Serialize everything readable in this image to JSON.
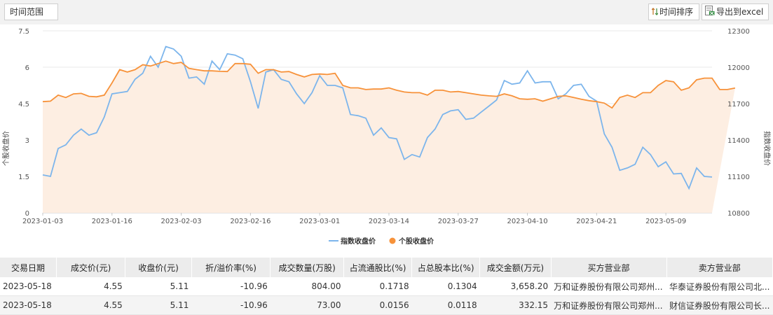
{
  "toolbar": {
    "range_label": "时间范围",
    "sort_label": "时间排序",
    "export_label": "导出到excel"
  },
  "chart_data": {
    "type": "line",
    "y_left": {
      "label": "个股收盘价",
      "ticks": [
        "7.5",
        "6",
        "4.5",
        "3",
        "1.5",
        "0"
      ],
      "range": [
        0,
        7.5
      ]
    },
    "y_right": {
      "label": "指数收盘价",
      "ticks": [
        "12300",
        "12000",
        "11700",
        "11400",
        "11100",
        "10800"
      ],
      "range": [
        10800,
        12300
      ]
    },
    "x_ticks": [
      "2023-01-03",
      "2023-01-16",
      "2023-02-03",
      "2023-02-16",
      "2023-03-01",
      "2023-03-14",
      "2023-03-27",
      "2023-04-10",
      "2023-04-21",
      "2023-05-09"
    ],
    "x_tick_index": [
      0,
      9,
      18,
      27,
      36,
      45,
      54,
      63,
      72,
      81
    ],
    "n_points": 88,
    "legend": "bottom-center",
    "grid": "horizontal",
    "colors": {
      "index": "#7cb5ec",
      "stock": "#f7923a",
      "fill": "#fdeee2"
    },
    "series": [
      {
        "name": "指数收盘价",
        "axis": "right",
        "values": [
          11112,
          11100,
          11330,
          11360,
          11440,
          11490,
          11440,
          11460,
          11590,
          11780,
          11790,
          11800,
          11900,
          11950,
          12090,
          12000,
          12170,
          12150,
          12090,
          11910,
          11920,
          11860,
          12050,
          11980,
          12110,
          12100,
          12070,
          11880,
          11660,
          11960,
          11980,
          11900,
          11880,
          11780,
          11700,
          11790,
          11930,
          11850,
          11850,
          11830,
          11610,
          11600,
          11580,
          11440,
          11500,
          11420,
          11410,
          11240,
          11280,
          11260,
          11420,
          11490,
          11610,
          11640,
          11650,
          11570,
          11580,
          11630,
          11680,
          11730,
          11890,
          11860,
          11870,
          11970,
          11870,
          11880,
          11880,
          11740,
          11780,
          11850,
          11860,
          11760,
          11720,
          11450,
          11340,
          11150,
          11170,
          11200,
          11340,
          11280,
          11180,
          11220,
          11120,
          11125,
          11000,
          11170,
          11100,
          11095
        ]
      },
      {
        "name": "个股收盘价",
        "axis": "left",
        "values": [
          4.58,
          4.6,
          4.85,
          4.75,
          4.9,
          4.92,
          4.8,
          4.78,
          4.85,
          5.35,
          5.9,
          5.8,
          5.9,
          6.1,
          6.05,
          6.15,
          6.25,
          6.15,
          6.2,
          5.95,
          5.9,
          5.85,
          5.85,
          5.83,
          5.82,
          6.15,
          6.15,
          6.12,
          5.75,
          5.9,
          5.9,
          5.8,
          5.82,
          5.7,
          5.6,
          5.7,
          5.72,
          5.7,
          5.75,
          5.25,
          5.15,
          5.15,
          5.08,
          5.1,
          5.1,
          5.15,
          5.05,
          4.98,
          4.95,
          4.95,
          4.85,
          5.05,
          5.05,
          4.98,
          5.0,
          4.95,
          4.9,
          4.85,
          4.82,
          4.8,
          4.9,
          4.82,
          4.7,
          4.68,
          4.7,
          4.6,
          4.7,
          4.8,
          4.82,
          4.75,
          4.68,
          4.62,
          4.58,
          4.52,
          4.32,
          4.75,
          4.85,
          4.75,
          4.95,
          4.95,
          5.25,
          5.45,
          5.4,
          5.05,
          5.15,
          5.48,
          5.55,
          5.55,
          5.08,
          5.08,
          5.14
        ]
      }
    ]
  },
  "table": {
    "headers": [
      "交易日期",
      "成交价(元)",
      "收盘价(元)",
      "折/溢价率(%)",
      "成交数量(万股)",
      "占流通股比(%)",
      "占总股本比(%)",
      "成交金额(万元)",
      "买方营业部",
      "卖方营业部"
    ],
    "rows": [
      [
        "2023-05-18",
        "4.55",
        "5.11",
        "-10.96",
        "804.00",
        "0.1718",
        "0.1304",
        "3,658.20",
        "万和证券股份有限公司郑州...",
        "华泰证券股份有限公司北..."
      ],
      [
        "2023-05-18",
        "4.55",
        "5.11",
        "-10.96",
        "73.00",
        "0.0156",
        "0.0118",
        "332.15",
        "万和证券股份有限公司郑州...",
        "财信证券股份有限公司长..."
      ]
    ]
  }
}
